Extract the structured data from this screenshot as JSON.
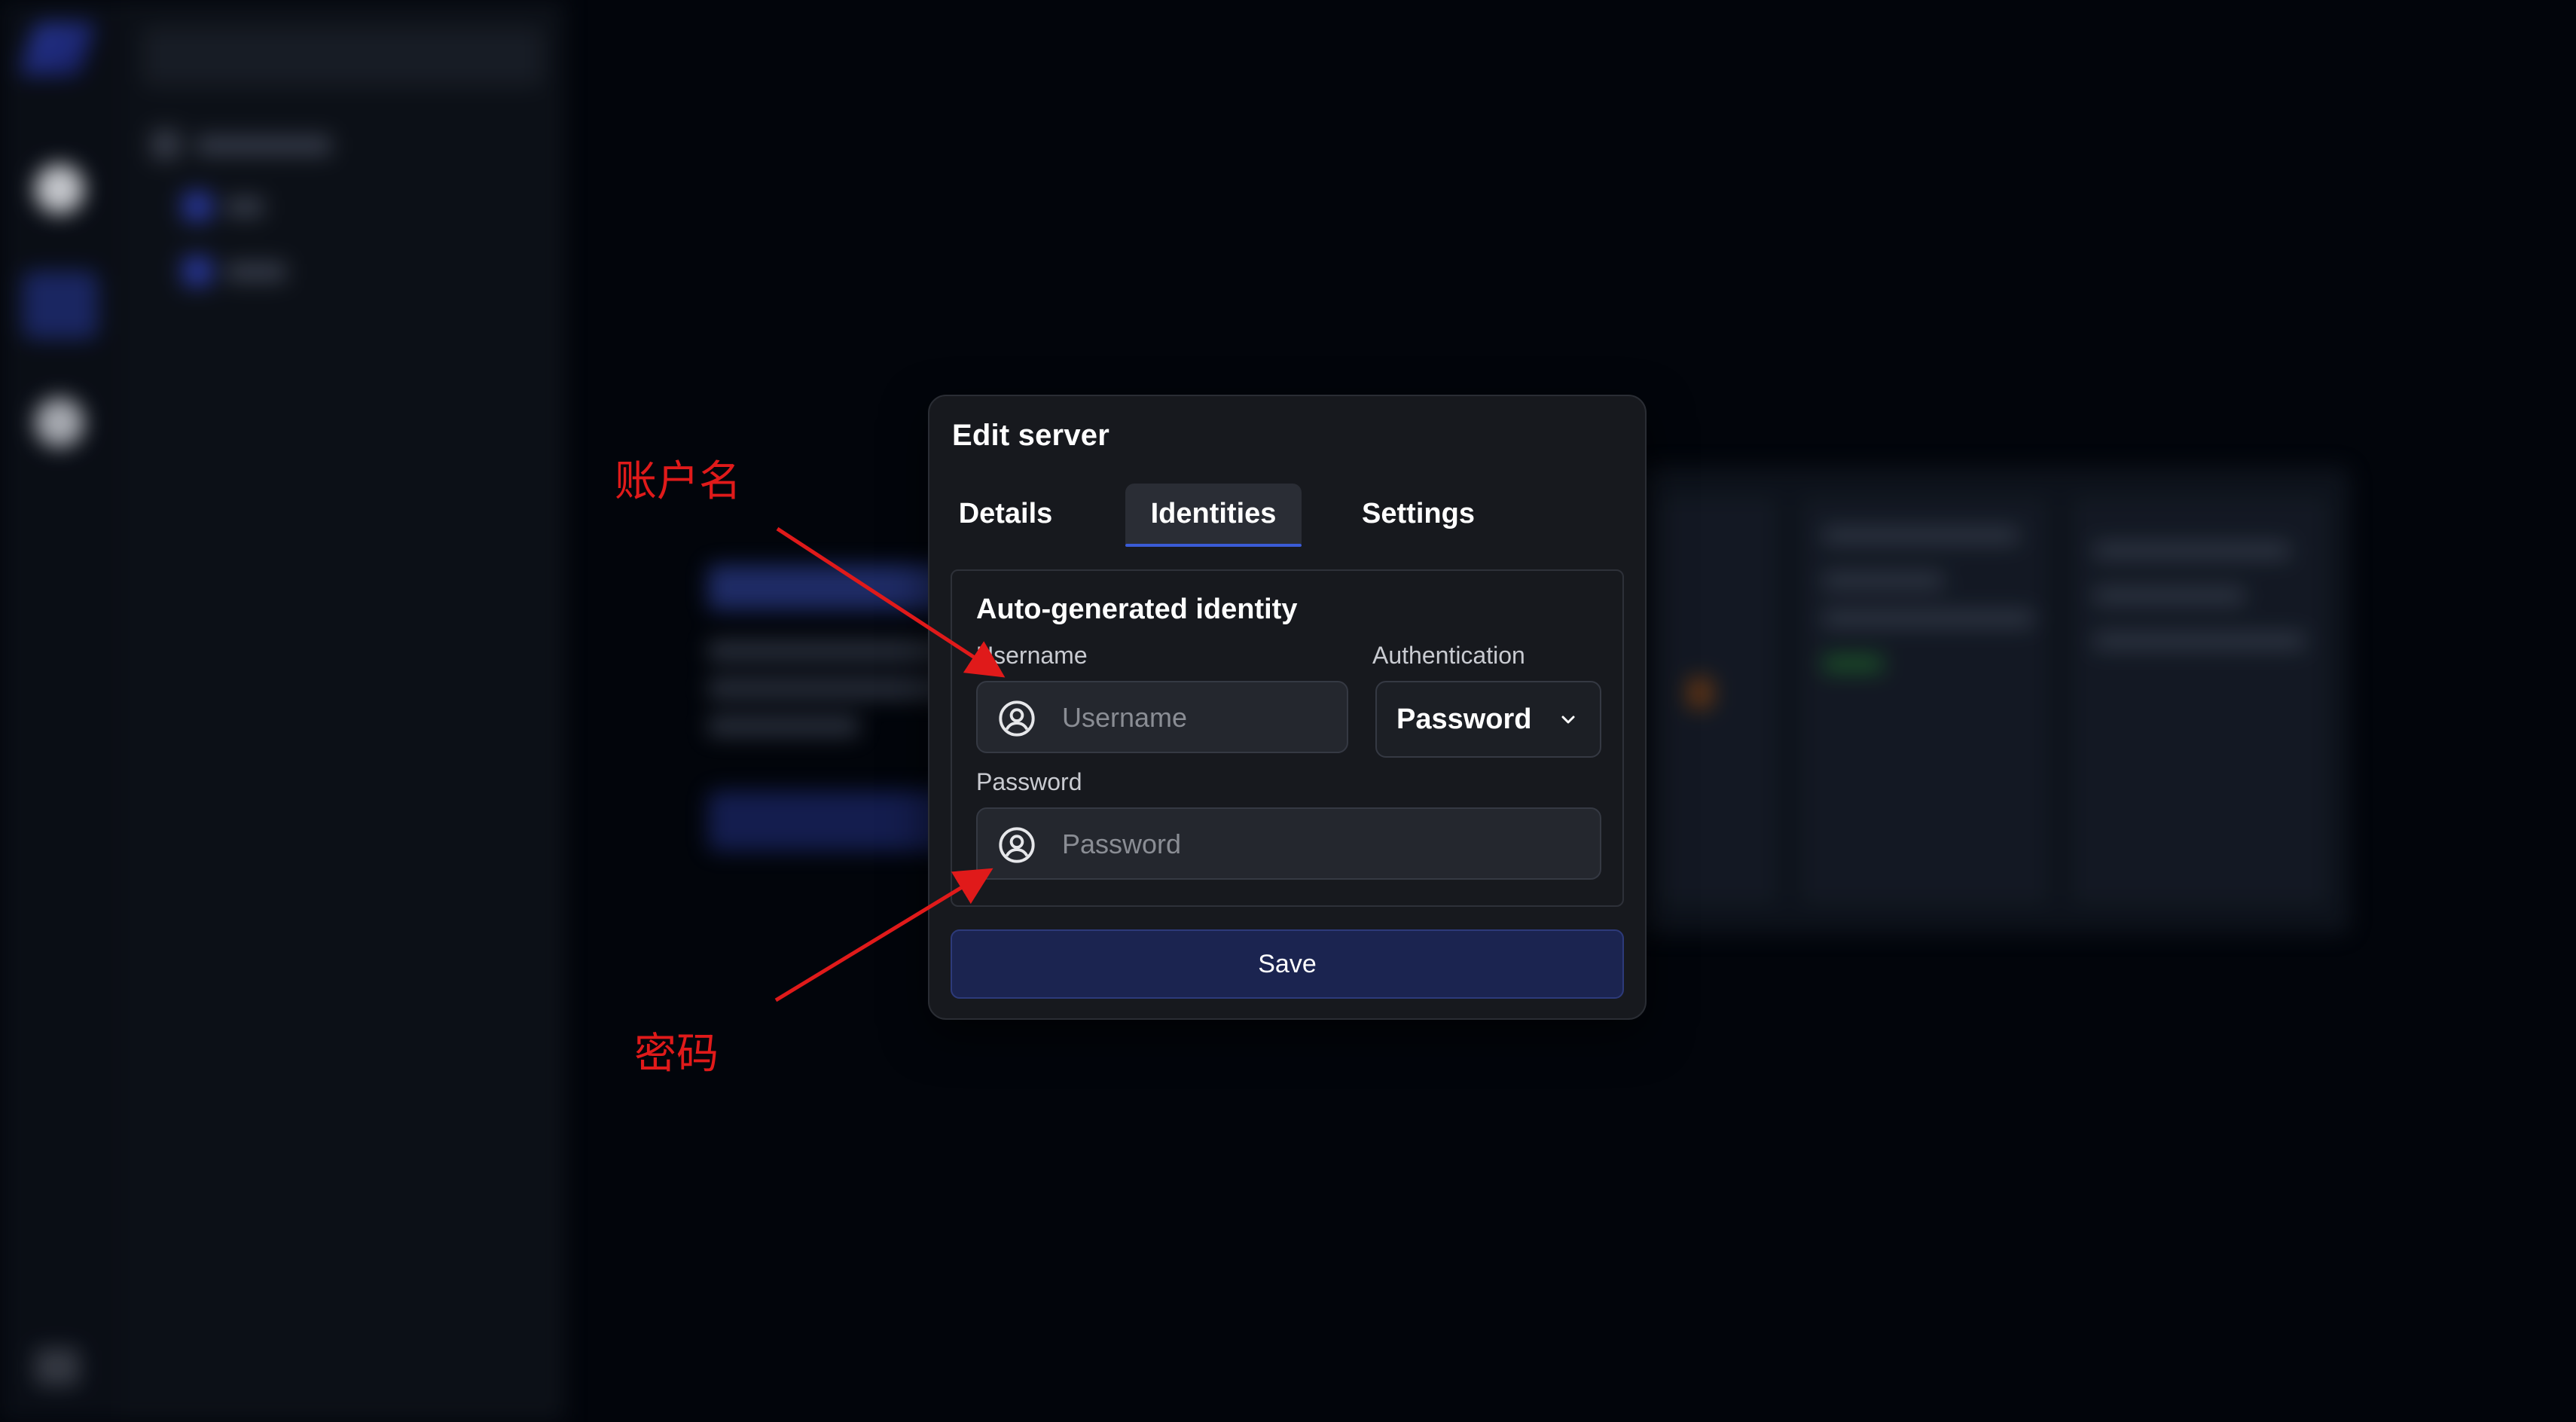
{
  "dialog": {
    "title": "Edit server",
    "tabs": [
      {
        "label": "Details"
      },
      {
        "label": "Identities",
        "active": true
      },
      {
        "label": "Settings"
      }
    ],
    "identity_group": {
      "title": "Auto-generated identity",
      "username": {
        "label": "Username",
        "placeholder": "Username",
        "value": "",
        "icon": "user-circle-icon"
      },
      "authentication": {
        "label": "Authentication",
        "selected": "Password",
        "icon": "chevron-down-icon"
      },
      "password": {
        "label": "Password",
        "placeholder": "Password",
        "value": "",
        "icon": "user-circle-icon"
      }
    },
    "save_label": "Save"
  },
  "annotations": {
    "username_note": "账户名",
    "password_note": "密码",
    "color": "#e01a1a"
  },
  "colors": {
    "accent": "#3a5bd6",
    "dialog_bg": "#17191e",
    "save_bg": "#1b2450"
  }
}
